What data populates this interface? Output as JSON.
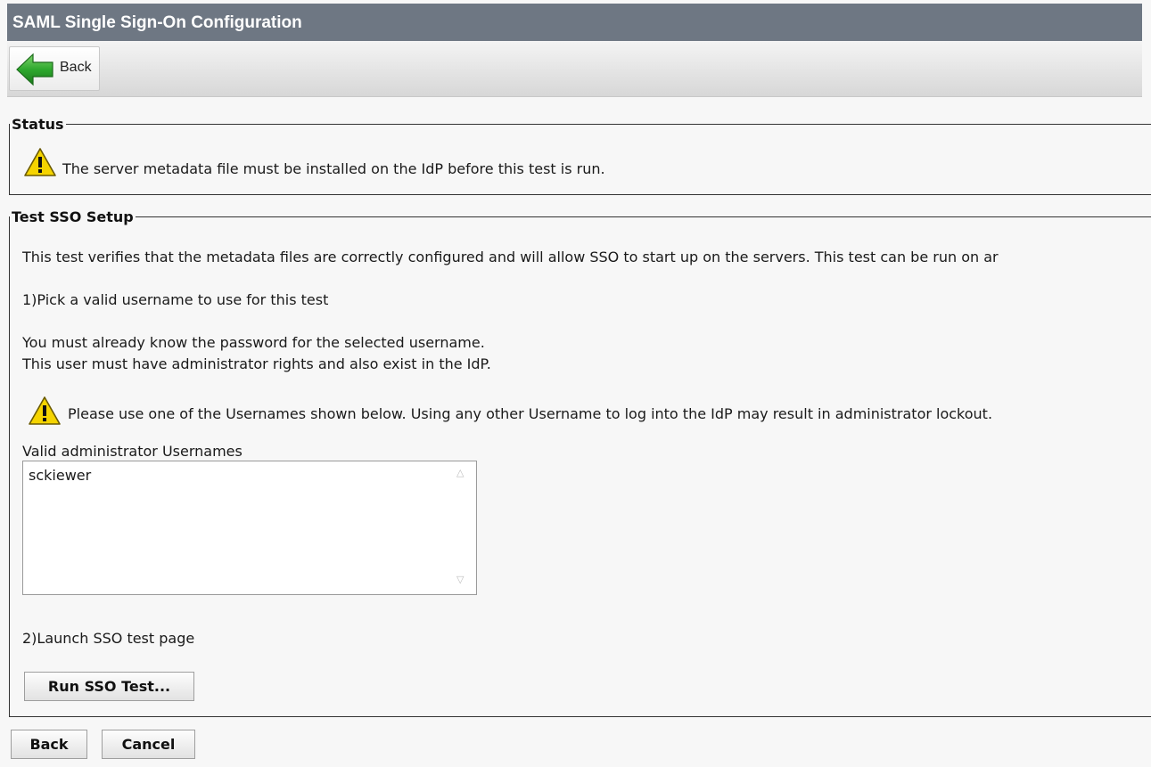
{
  "window": {
    "title": "SAML Single Sign-On Configuration"
  },
  "toolbar": {
    "back_label": "Back",
    "back_icon": "green-left-arrow-icon"
  },
  "status": {
    "legend": "Status",
    "message": "The server metadata file must be installed on the IdP before this test is run.",
    "icon": "warning-icon"
  },
  "test_setup": {
    "legend": "Test SSO Setup",
    "intro": "This test verifies that the metadata files are correctly configured and will allow SSO to start up on the servers. This test can be run on ar",
    "step1": "1)Pick a valid username to use for this test",
    "note_line1": "You must already know the password for the selected username.",
    "note_line2": "This user must have administrator rights and also exist in the IdP.",
    "warning": "Please use one of the Usernames shown below. Using any other Username to log into the IdP may result in administrator lockout.",
    "list_label": "Valid administrator Usernames",
    "usernames": [
      "sckiewer"
    ],
    "step2": "2)Launch SSO test page",
    "run_button": "Run SSO Test..."
  },
  "footer": {
    "back_label": "Back",
    "cancel_label": "Cancel"
  },
  "colors": {
    "title_bar": "#6e7783",
    "warning_yellow": "#f5d400",
    "arrow_green": "#2ea82e"
  }
}
